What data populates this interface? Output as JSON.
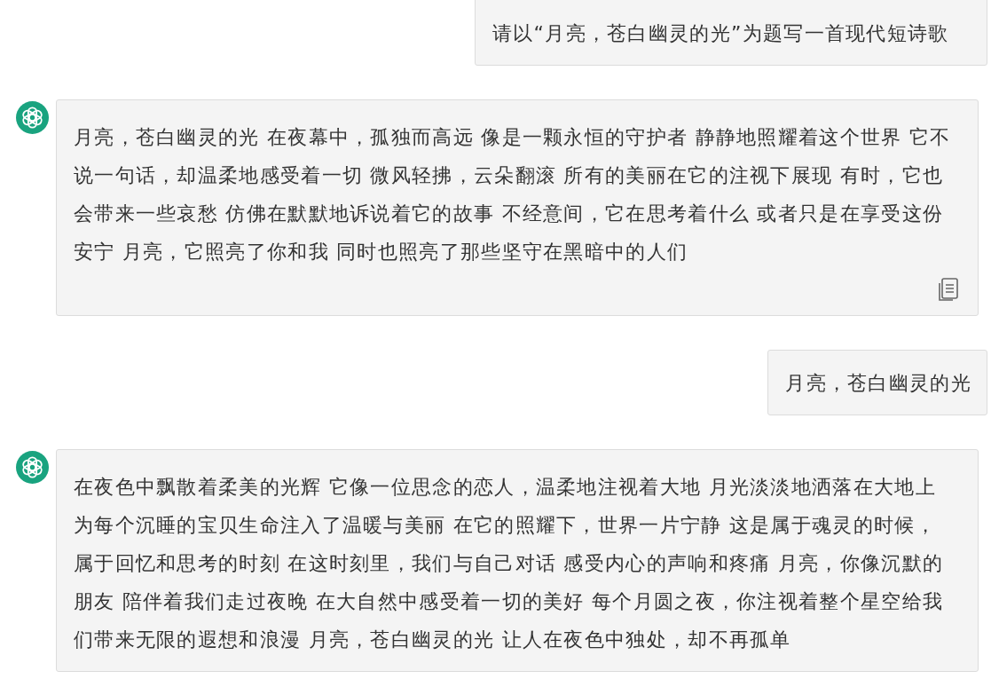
{
  "messages": [
    {
      "kind": "user",
      "text": "请以“月亮，苍白幽灵的光”为题写一首现代短诗歌"
    },
    {
      "kind": "assistant",
      "text": "月亮，苍白幽灵的光 在夜幕中，孤独而高远 像是一颗永恒的守护者 静静地照耀着这个世界 它不说一句话，却温柔地感受着一切 微风轻拂，云朵翻滚 所有的美丽在它的注视下展现 有时，它也会带来一些哀愁 仿佛在默默地诉说着它的故事 不经意间，它在思考着什么 或者只是在享受这份安宁 月亮，它照亮了你和我 同时也照亮了那些坚守在黑暗中的人们",
      "copy_button": true
    },
    {
      "kind": "user",
      "text": "月亮，苍白幽灵的光"
    },
    {
      "kind": "assistant",
      "text": "在夜色中飘散着柔美的光辉 它像一位思念的恋人，温柔地注视着大地 月光淡淡地洒落在大地上为每个沉睡的宝贝生命注入了温暖与美丽 在它的照耀下，世界一片宁静 这是属于魂灵的时候，属于回忆和思考的时刻 在这时刻里，我们与自己对话 感受内心的声响和疼痛 月亮，你像沉默的朋友 陪伴着我们走过夜晚 在大自然中感受着一切的美好 每个月圆之夜，你注视着整个星空给我们带来无限的遐想和浪漫 月亮，苍白幽灵的光 让人在夜色中独处，却不再孤单",
      "copy_button": false
    }
  ]
}
